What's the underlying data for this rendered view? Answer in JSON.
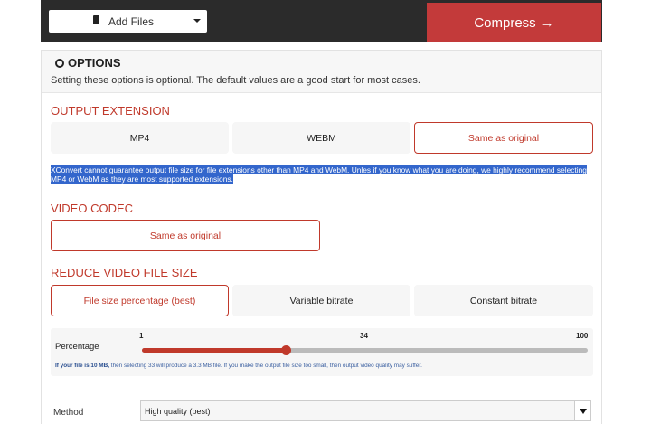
{
  "topbar": {
    "add_files_label": "Add Files",
    "compress_label": "Compress",
    "compress_arrow": "→"
  },
  "options": {
    "title": "OPTIONS",
    "description": "Setting these options is optional. The default values are a good start for most cases."
  },
  "output_extension": {
    "heading": "OUTPUT EXTENSION",
    "options": [
      "MP4",
      "WEBM",
      "Same as original"
    ],
    "selected": "Same as original",
    "warning": "XConvert cannot guarantee output file size for file extensions other than MP4 and WebM. Unles if you know what you are doing, we highly recommend selecting MP4 or WebM as they are most supported extensions."
  },
  "video_codec": {
    "heading": "VIDEO CODEC",
    "selected": "Same as original"
  },
  "reduce": {
    "heading": "REDUCE VIDEO FILE SIZE",
    "options": [
      "File size percentage (best)",
      "Variable bitrate",
      "Constant bitrate"
    ],
    "selected": "File size percentage (best)"
  },
  "percentage": {
    "label": "Percentage",
    "min_label": "1",
    "mid_label": "34",
    "max_label": "100",
    "value": 33,
    "hint_bold": "If your file is 10 MB,",
    "hint_rest": "then selecting 33 will produce a 3.3 MB file. If you make the output file size too small, then output video quality may suffer."
  },
  "method": {
    "label": "Method",
    "value": "High quality (best)"
  },
  "colors": {
    "accent": "#c0392b",
    "compress_bg": "#c33a3a",
    "topbar_bg": "#2b2b2b",
    "highlight": "#3366cc"
  }
}
